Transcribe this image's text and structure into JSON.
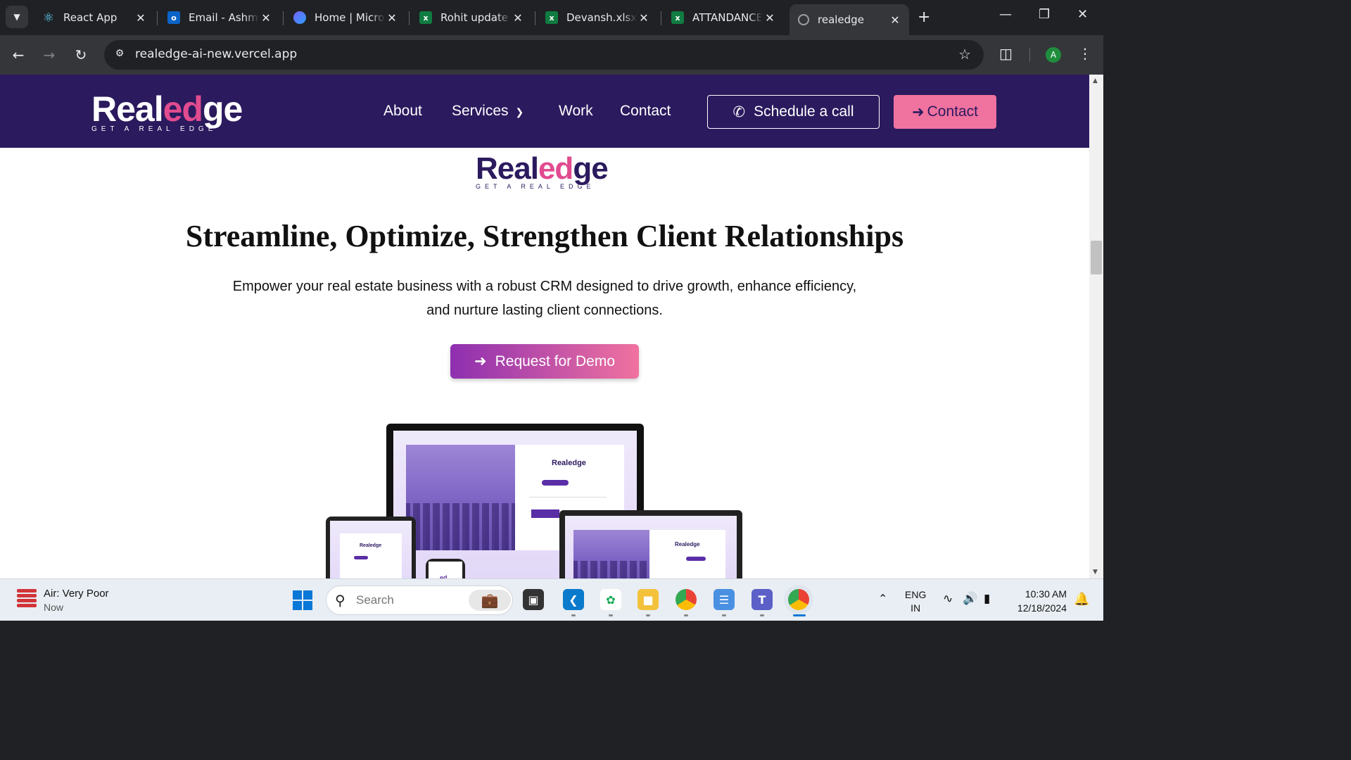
{
  "browser": {
    "tabs": [
      {
        "title": "React App",
        "icon": "react-icon",
        "active": false
      },
      {
        "title": "Email - Ashmit",
        "icon": "outlook-icon",
        "active": false
      },
      {
        "title": "Home | Micros",
        "icon": "copilot-icon",
        "active": false
      },
      {
        "title": "Rohit update l",
        "icon": "excel-icon",
        "active": false
      },
      {
        "title": "Devansh.xlsx",
        "icon": "excel-icon",
        "active": false
      },
      {
        "title": "ATTANDANCE",
        "icon": "excel-icon",
        "active": false
      },
      {
        "title": "realedge",
        "icon": "globe-icon",
        "active": true
      }
    ],
    "url": "realedge-ai-new.vercel.app",
    "profile_initial": "A"
  },
  "site": {
    "logo": {
      "word_a": "Real",
      "word_e": "ed",
      "word_b": "ge",
      "tagline": "GET A REAL EDGE"
    },
    "nav": {
      "about": "About",
      "services": "Services",
      "work": "Work",
      "contact": "Contact"
    },
    "schedule_label": "Schedule a call",
    "contact_label": "Contact",
    "hero": {
      "headline": "Streamline, Optimize, Strengthen Client Relationships",
      "subtext": "Empower your real estate business with a robust CRM designed to drive growth, enhance efficiency, and nurture lasting client connections.",
      "demo_label": "Request for Demo"
    },
    "mockup": {
      "logo": "Realedge",
      "phone_logo": "ed"
    },
    "colors": {
      "header_bg": "#2b1a5e",
      "accent_pink": "#f0729f",
      "accent_purple": "#8e2fb0"
    }
  },
  "taskbar": {
    "weather_title": "Air: Very Poor",
    "weather_sub": "Now",
    "search_placeholder": "Search",
    "lang_top": "ENG",
    "lang_bottom": "IN",
    "time": "10:30 AM",
    "date": "12/18/2024"
  }
}
